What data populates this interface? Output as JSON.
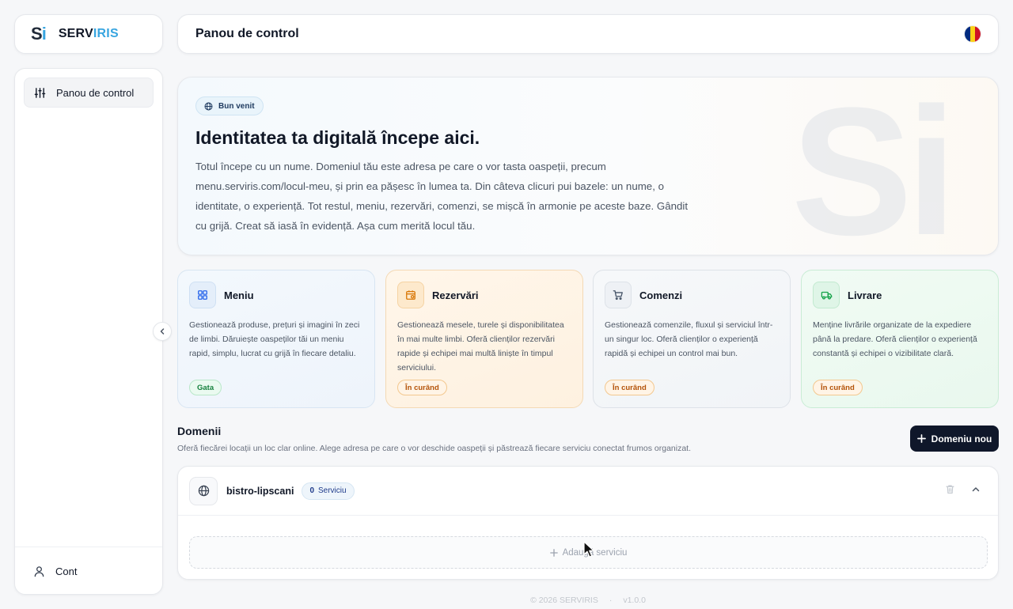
{
  "brand": {
    "mark_s": "S",
    "mark_i": "i",
    "name_a": "SERV",
    "name_b": "IRIS"
  },
  "header": {
    "title": "Panou de control",
    "language_icon": "romania-flag-icon"
  },
  "sidebar": {
    "items": [
      {
        "label": "Panou de control",
        "icon": "sliders-icon",
        "active": true
      }
    ],
    "account": {
      "label": "Cont",
      "icon": "user-icon"
    }
  },
  "hero": {
    "badge": "Bun venit",
    "title": "Identitatea ta digitală începe aici.",
    "text": "Totul începe cu un nume. Domeniul tău este adresa pe care o vor tasta oaspeții, precum menu.serviris.com/locul-meu, și prin ea pășesc în lumea ta. Din câteva clicuri pui bazele: un nume, o identitate, o experiență. Tot restul, meniu, rezervări, comenzi, se mișcă în armonie pe aceste baze. Gândit cu grijă. Creat să iasă în evidență. Așa cum merită locul tău.",
    "watermark": "Si"
  },
  "features": [
    {
      "name": "Meniu",
      "icon": "grid-icon",
      "description": "Gestionează produse, prețuri și imagini în zeci de limbi. Dăruiește oaspeților tăi un meniu rapid, simplu, lucrat cu grijă în fiecare detaliu.",
      "status": "Gata",
      "accent": "#2563eb"
    },
    {
      "name": "Rezervări",
      "icon": "calendar-icon",
      "description": "Gestionează mesele, turele și disponibilitatea în mai multe limbi. Oferă clienților rezervări rapide și echipei mai multă liniște în timpul serviciului.",
      "status": "În curând",
      "accent": "#d97706"
    },
    {
      "name": "Comenzi",
      "icon": "cart-icon",
      "description": "Gestionează comenzile, fluxul și serviciul într-un singur loc. Oferă clienților o experiență rapidă și echipei un control mai bun.",
      "status": "În curând",
      "accent": "#475569"
    },
    {
      "name": "Livrare",
      "icon": "truck-icon",
      "description": "Menține livrările organizate de la expediere până la predare. Oferă clienților o experiență constantă și echipei o vizibilitate clară.",
      "status": "În curând",
      "accent": "#16a34a"
    }
  ],
  "domains": {
    "title": "Domenii",
    "subtitle": "Oferă fiecărei locații un loc clar online. Alege adresa pe care o vor deschide oaspeții și păstrează fiecare serviciu conectat frumos organizat.",
    "new_button": "Domeniu nou",
    "items": [
      {
        "name": "bistro-lipscani",
        "service_count": "0",
        "service_label": "Serviciu",
        "add_service_label": "Adaugă serviciu"
      }
    ]
  },
  "footer": {
    "copyright": "© 2026 SERVIRIS",
    "version": "v1.0.0"
  }
}
